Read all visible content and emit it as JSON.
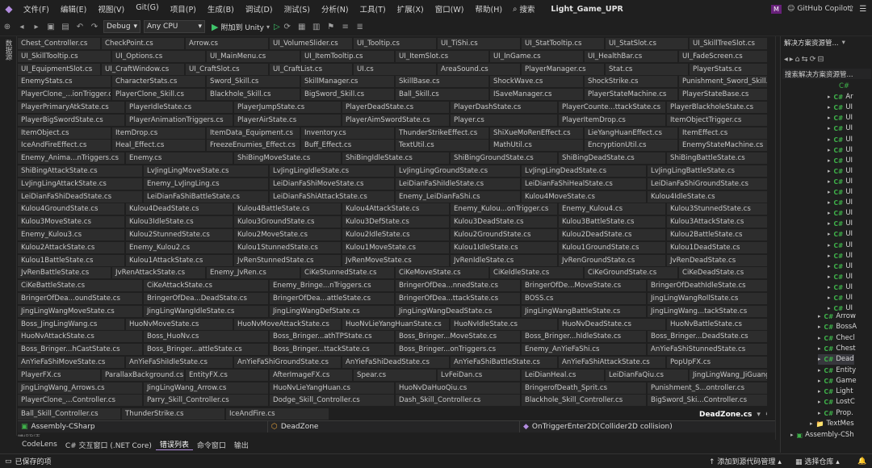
{
  "menu": {
    "items": [
      "文件(F)",
      "编辑(E)",
      "视图(V)",
      "Git(G)",
      "项目(P)",
      "生成(B)",
      "调试(D)",
      "测试(S)",
      "分析(N)",
      "工具(T)",
      "扩展(X)",
      "窗口(W)",
      "帮助(H)"
    ],
    "search_label": "搜索",
    "solution_title": "Light_Game_UPR",
    "copilot_label": "GitHub Copilot"
  },
  "toolbar": {
    "config": "Debug",
    "platform": "Any CPU",
    "attach_label": "附加到 Unity"
  },
  "left_strip_label": "数据源",
  "tab_rows": [
    [
      "Chest_Controller.cs",
      "CheckPoint.cs",
      "Arrow.cs",
      "UI_VolumeSlider.cs",
      "UI_Tooltip.cs",
      "UI_TiShi.cs",
      "UI_StatTooltip.cs",
      "UI_StatSlot.cs",
      "UI_SkillTreeSlot.cs"
    ],
    [
      "UI_SkillTooltip.cs",
      "UI_Options.cs",
      "UI_MainMenu.cs",
      "UI_ItemTooltip.cs",
      "UI_ItemSlot.cs",
      "UI_InGame.cs",
      "UI_HealthBar.cs",
      "UI_FadeScreen.cs"
    ],
    [
      "UI_EquipmentSlot.cs",
      "UI_CraftWindow.cs",
      "UI_CraftSlot.cs",
      "UI_CraftList.cs",
      "UI.cs",
      "AreaSound.cs",
      "PlayerManager.cs",
      "Stat.cs",
      "PlayerStats.cs"
    ],
    [
      "EnemyStats.cs",
      "CharacterStats.cs",
      "Sword_Skill.cs",
      "SkillManager.cs",
      "SkillBase.cs",
      "ShockWave.cs",
      "ShockStrike.cs",
      "Punishment_Sword_Skill.cs"
    ],
    [
      "PlayerClone_...ionTrigger.cs",
      "PlayerClone_Skill.cs",
      "Blackhole_Skill.cs",
      "BigSword_Skill.cs",
      "Ball_Skill.cs",
      "ISaveManager.cs",
      "PlayerStateMachine.cs",
      "PlayerStateBase.cs"
    ],
    [
      "PlayerPrimaryAtkState.cs",
      "PlayerIdleState.cs",
      "PlayerJumpState.cs",
      "PlayerDeadState.cs",
      "PlayerDashState.cs",
      "PlayerCounte...ttackState.cs",
      "PlayerBlackholeState.cs"
    ],
    [
      "PlayerBigSwordState.cs",
      "PlayerAnimationTriggers.cs",
      "PlayerAirState.cs",
      "PlayerAimSwordState.cs",
      "Player.cs",
      "PlayerItemDrop.cs",
      "ItemObjectTrigger.cs"
    ],
    [
      "ItemObject.cs",
      "ItemDrop.cs",
      "ItemData_Equipment.cs",
      "Inventory.cs",
      "ThunderStrikeEffect.cs",
      "ShiXueMoRenEffect.cs",
      "LieYangHuanEffect.cs",
      "ItemEffect.cs"
    ],
    [
      "IceAndFireEffect.cs",
      "Heal_Effect.cs",
      "FreezeEnumies_Effect.cs",
      "Buff_Effect.cs",
      "TextUtil.cs",
      "MathUtil.cs",
      "EncryptionUtil.cs",
      "EnemyStateMachine.cs"
    ],
    [
      "Enemy_Anima...nTriggers.cs",
      "Enemy.cs",
      "ShiBingMoveState.cs",
      "ShiBingIdleState.cs",
      "ShiBingGroundState.cs",
      "ShiBingDeadState.cs",
      "ShiBingBattleState.cs"
    ],
    [
      "ShiBingAttackState.cs",
      "LvJingLingMoveState.cs",
      "LvJingLingIdleState.cs",
      "LvJingLingGroundState.cs",
      "LvJingLingDeadState.cs",
      "LvJingLingBattleState.cs"
    ],
    [
      "LvJingLingAttackState.cs",
      "Enemy_LvJingLing.cs",
      "LeiDianFaShiMoveState.cs",
      "LeiDianFaShiIdleState.cs",
      "LeiDianFaShiHealState.cs",
      "LeiDianFaShiGroundState.cs"
    ],
    [
      "LeiDianFaShiDeadState.cs",
      "LeiDianFaShiBattleState.cs",
      "LeiDianFaShiAttackState.cs",
      "Enemy_LeiDianFaShi.cs",
      "Kulou4MoveState.cs",
      "Kulou4IdleState.cs"
    ],
    [
      "Kulou4GroundState.cs",
      "Kulou4DeadState.cs",
      "Kulou4BattleState.cs",
      "Kulou4AttackState.cs",
      "Enemy_Kulou...onTrigger.cs",
      "Enemy_Kulou4.cs",
      "Kulou3StunnedState.cs"
    ],
    [
      "Kulou3MoveState.cs",
      "Kulou3IdleState.cs",
      "Kulou3GroundState.cs",
      "Kulou3DefState.cs",
      "Kulou3DeadState.cs",
      "Kulou3BattleState.cs",
      "Kulou3AttackState.cs"
    ],
    [
      "Enemy_Kulou3.cs",
      "Kulou2StunnedState.cs",
      "Kulou2MoveState.cs",
      "Kulou2IdleState.cs",
      "Kulou2GroundState.cs",
      "Kulou2DeadState.cs",
      "Kulou2BattleState.cs"
    ],
    [
      "Kulou2AttackState.cs",
      "Enemy_Kulou2.cs",
      "Kulou1StunnedState.cs",
      "Kulou1MoveState.cs",
      "Kulou1IdleState.cs",
      "Kulou1GroundState.cs",
      "Kulou1DeadState.cs"
    ],
    [
      "Kulou1BattleState.cs",
      "Kulou1AttackState.cs",
      "JvRenStunnedState.cs",
      "JvRenMoveState.cs",
      "JvRenIdleState.cs",
      "JvRenGroundState.cs",
      "JvRenDeadState.cs"
    ],
    [
      "JvRenBattleState.cs",
      "JvRenAttackState.cs",
      "Enemy_JvRen.cs",
      "CiKeStunnedState.cs",
      "CiKeMoveState.cs",
      "CiKeIdleState.cs",
      "CiKeGroundState.cs",
      "CiKeDeadState.cs"
    ],
    [
      "CiKeBattleState.cs",
      "CiKeAttackState.cs",
      "Enemy_Bringe...nTriggers.cs",
      "BringerOfDea...nnedState.cs",
      "BringerOfDe...MoveState.cs",
      "BringerOfDeathIdleState.cs"
    ],
    [
      "BringerOfDea...oundState.cs",
      "BringerOfDea...DeadState.cs",
      "BringerOfDea...attleState.cs",
      "BringerOfDea...ttackState.cs",
      "BOSS.cs",
      "JingLingWangRollState.cs"
    ],
    [
      "JingLingWangMoveState.cs",
      "JingLingWangIdleState.cs",
      "JingLingWangDefState.cs",
      "JingLingWangDeadState.cs",
      "JingLingWangBattleState.cs",
      "JingLingWang...tackState.cs"
    ],
    [
      "Boss_JingLingWang.cs",
      "HuoNvMoveState.cs",
      "HuoNvMoveAttackState.cs",
      "HuoNvLieYangHuanState.cs",
      "HuoNvIdleState.cs",
      "HuoNvDeadState.cs",
      "HuoNvBattleState.cs"
    ],
    [
      "HuoNvAttackState.cs",
      "Boss_HuoNv.cs",
      "Boss_Bringer...athTPState.cs",
      "Boss_Bringer...MoveState.cs",
      "Boss_Bringer...hIdleState.cs",
      "Boss_Bringer...DeadState.cs"
    ],
    [
      "Boss_Bringer...hCastState.cs",
      "Boss_Bringer...attleState.cs",
      "Boss_Bringer...ttackState.cs",
      "Boss_Bringer...onTriggers.cs",
      "Enemy_AnYieFaShi.cs",
      "AnYieFaShiStunnedState.cs"
    ],
    [
      "AnYieFaShiMoveState.cs",
      "AnYieFaShiIdleState.cs",
      "AnYieFaShiGroundState.cs",
      "AnYieFaShiDeadState.cs",
      "AnYieFaShiBattleState.cs",
      "AnYieFaShiAttackState.cs",
      "PopUpFX.cs"
    ],
    [
      "PlayerFX.cs",
      "ParallaxBackground.cs",
      "EntityFX.cs",
      "AfterImageFX.cs",
      "Spear.cs",
      "LvFeiDan.cs",
      "LeiDianHeal.cs",
      "LeiDianFaQiu.cs",
      "JingLingWang_JiGuang.cs"
    ],
    [
      "JingLingWang_Arrows.cs",
      "JingLingWang_Arrow.cs",
      "HuoNvLieYangHuan.cs",
      "HuoNvDaHuoQiu.cs",
      "BringerofDeath_Sprit.cs",
      "Punishment_S...ontroller.cs"
    ],
    [
      "PlayerClone_...Controller.cs",
      "Parry_Skill_Controller.cs",
      "Dodge_Skill_Controller.cs",
      "Dash_Skill_Controller.cs",
      "Blackhole_Skill_Controller.cs",
      "BigSword_Ski...Controller.cs"
    ]
  ],
  "last_row": [
    "Ball_Skill_Controller.cs",
    "ThunderStrike.cs",
    "IceAndFire.cs"
  ],
  "active_tab": "DeadZone.cs",
  "navbar": {
    "project": "Assembly-CSharp",
    "type": "DeadZone",
    "member": "OnTriggerEnter2D(Collider2D collision)"
  },
  "panel_caption": "错误列表",
  "bottom_tabs": [
    "CodeLens",
    "C# 交互窗口 (.NET Core)",
    "错误列表",
    "命令窗口",
    "输出"
  ],
  "status": {
    "saved": "已保存的项",
    "add_source": "添加到源代码管理",
    "select_repo": "选择仓库"
  },
  "solution_explorer": {
    "title": "解决方案资源管...",
    "search_placeholder": "搜索解决方案资源管...",
    "upper_items": [
      "C#",
      "Ar",
      "UI",
      "UI",
      "UI",
      "UI",
      "UI",
      "UI",
      "UI",
      "UI",
      "UI",
      "UI",
      "UI",
      "UI",
      "UI",
      "UI",
      "UI",
      "UI",
      "UI",
      "UI",
      "UI",
      "UI"
    ],
    "lower_items": [
      "Arrow",
      "BossA",
      "Checl",
      "Chest",
      "Dead",
      "Entity",
      "Game",
      "Light",
      "LostC",
      "Prop."
    ],
    "folder": "TextMes",
    "project": "Assembly-CSh"
  },
  "colors": {
    "background": "#1f1f1f",
    "tab": "#2d2d2d",
    "accent": "#b28ce0",
    "csharp": "#3fb24a"
  }
}
